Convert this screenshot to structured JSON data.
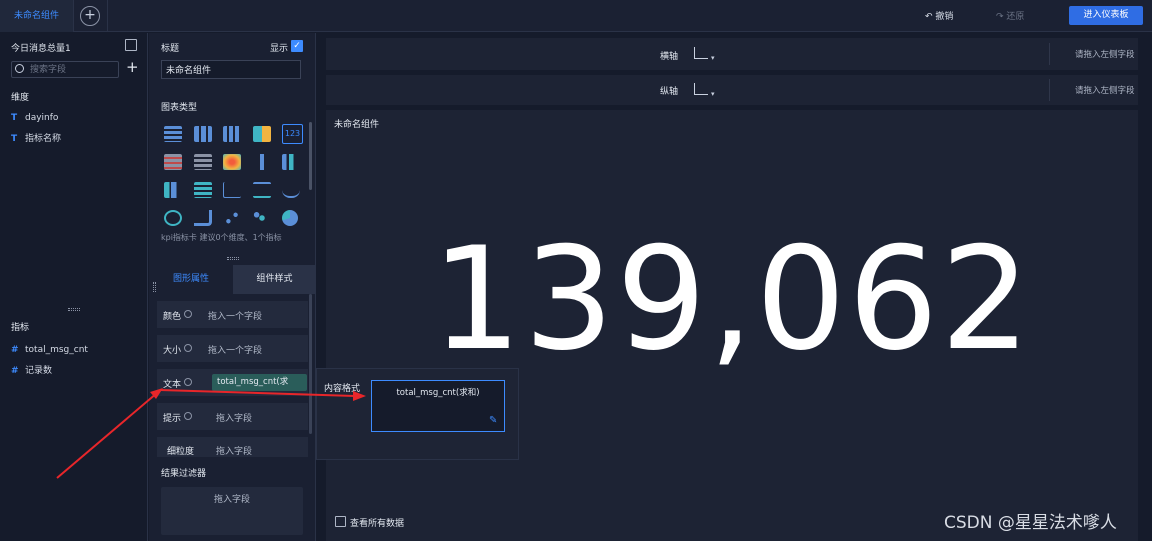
{
  "topbar": {
    "active_tab": "未命名组件",
    "add_tab_symbol": "+",
    "undo_label": "撤销",
    "undo_icon": "↶",
    "redo_label": "还原",
    "redo_icon": "↷",
    "enter_dashboard_label": "进入仪表板"
  },
  "fields": {
    "dataset_title": "今日消息总量1",
    "search_placeholder": "搜索字段",
    "add_symbol": "+",
    "dimension_title": "维度",
    "dimensions": [
      {
        "icon": "T",
        "label": "dayinfo"
      },
      {
        "icon": "T",
        "label": "指标名称"
      }
    ],
    "metric_title": "指标",
    "metrics": [
      {
        "icon": "#",
        "label": "total_msg_cnt"
      },
      {
        "icon": "#",
        "label": "记录数"
      }
    ]
  },
  "config": {
    "label_title": "标题",
    "show_label": "显示",
    "show_checked": "✓",
    "title_value": "未命名组件",
    "chart_type_title": "图表类型",
    "chart_hint": "kpi指标卡 建议0个维度、1个指标",
    "tab_graphic": "图形属性",
    "tab_component": "组件样式",
    "props": [
      {
        "label": "颜色",
        "value": "拖入一个字段"
      },
      {
        "label": "大小",
        "value": "拖入一个字段"
      },
      {
        "label": "文本",
        "value": ""
      },
      {
        "label": "提示",
        "value": "拖入字段"
      },
      {
        "label": "细粒度",
        "value": "拖入字段"
      }
    ],
    "text_chip": "total_msg_cnt(求",
    "filter_title": "结果过滤器",
    "filter_hint": "拖入字段"
  },
  "popup": {
    "title": "内容格式",
    "field": "total_msg_cnt(求和)",
    "edit_icon": "✎"
  },
  "canvas": {
    "x_axis_label": "横轴",
    "y_axis_label": "纵轴",
    "x_axis_hint": "请拖入左侧字段",
    "y_axis_hint": "请拖入左侧字段",
    "title": "未命名组件",
    "kpi_value": "139,062",
    "view_all_label": "查看所有数据"
  },
  "watermark": "CSDN @星星法术嗲人",
  "colors": {
    "accent": "#3d8bff",
    "background": "#151b2b",
    "panel": "#1a2032",
    "arrow": "#e8262a",
    "chip": "#2a5d5a"
  }
}
